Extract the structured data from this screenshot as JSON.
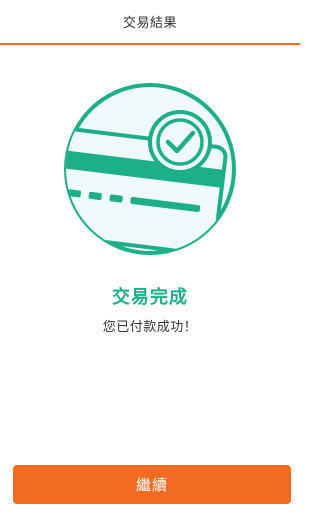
{
  "header": {
    "title": "交易結果"
  },
  "illustration": {
    "icon": "card-check-icon",
    "accent_color": "#1daf8a",
    "background_color": "#f0f9fa"
  },
  "result": {
    "title": "交易完成",
    "message": "您已付款成功！"
  },
  "actions": {
    "continue_label": "繼續",
    "button_color": "#f26b22"
  }
}
